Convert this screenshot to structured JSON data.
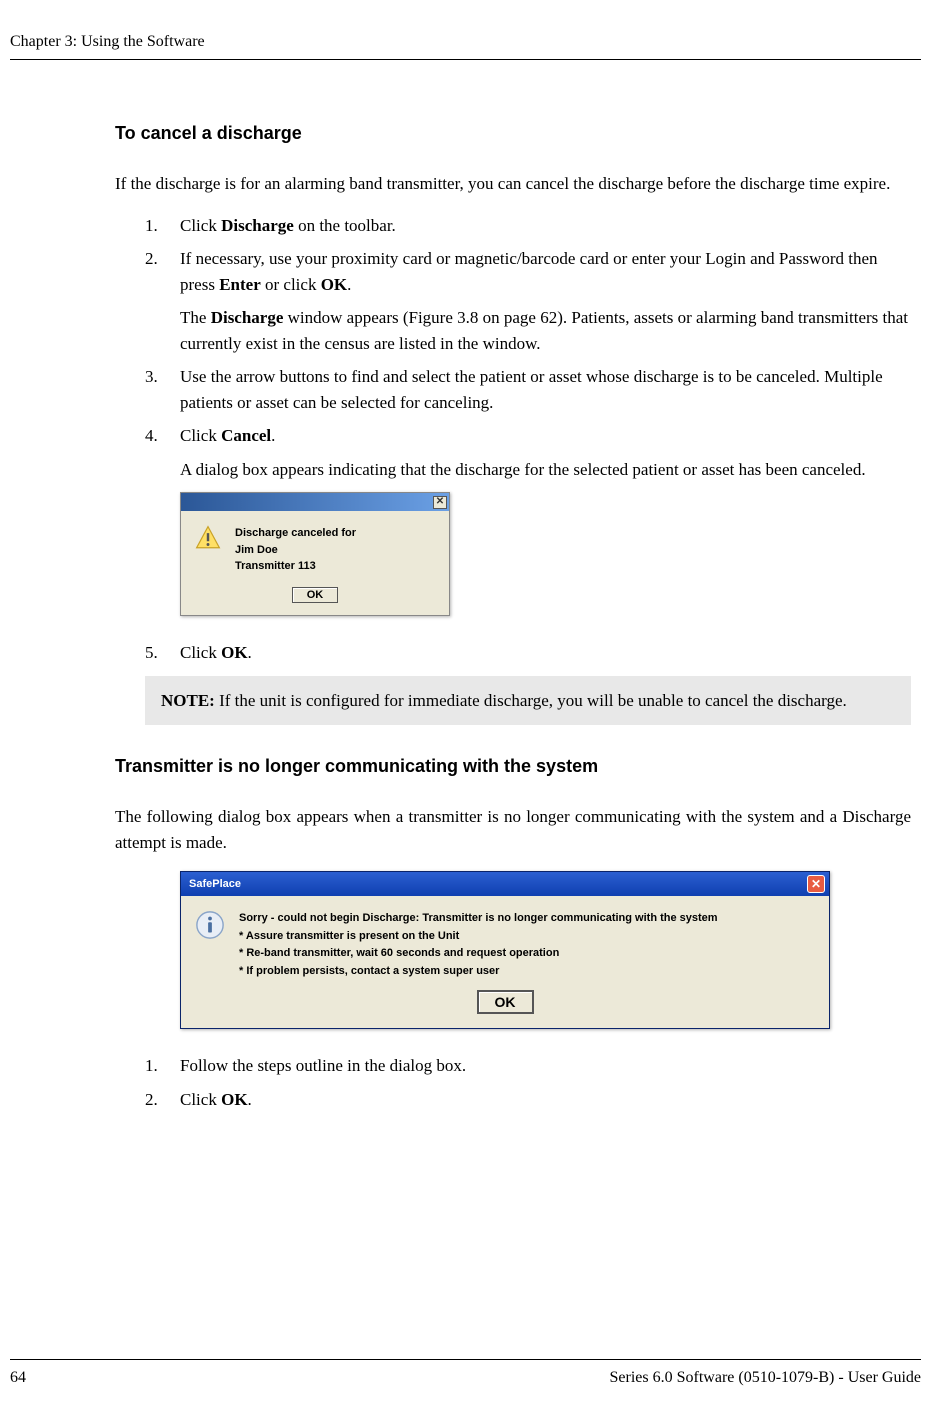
{
  "header": {
    "chapter": "Chapter 3: Using the Software"
  },
  "section1": {
    "title": "To cancel a discharge",
    "intro": "If the discharge is for an alarming band transmitter, you can cancel the discharge before the discharge time expire.",
    "steps": [
      {
        "num": "1.",
        "text_before": "Click ",
        "bold1": "Discharge",
        "text_after": " on the toolbar."
      },
      {
        "num": "2.",
        "text_before": "If necessary, use your proximity card or magnetic/barcode card or enter your Login and Password then press ",
        "bold1": "Enter",
        "text_mid": " or click ",
        "bold2": "OK",
        "text_after": ".",
        "sub_para": {
          "prefix": "The ",
          "bold": "Discharge",
          "suffix": " window appears (Figure 3.8 on page 62). Patients, assets or alarming band transmitters that currently exist in the census are listed in the window."
        }
      },
      {
        "num": "3.",
        "text": "Use the arrow buttons to find and select the patient or asset whose discharge is to be canceled. Multiple patients or asset can be selected for canceling."
      },
      {
        "num": "4.",
        "text_before": "Click ",
        "bold1": "Cancel",
        "text_after": ".",
        "sub_text": "A dialog box appears indicating that the discharge for the selected patient or asset has been canceled."
      },
      {
        "num": "5.",
        "text_before": "Click ",
        "bold1": "OK",
        "text_after": "."
      }
    ]
  },
  "dialog1": {
    "line1": "Discharge canceled for",
    "line2": "Jim Doe",
    "line3": "Transmitter 113",
    "ok": "OK"
  },
  "note": {
    "label": "NOTE:",
    "text": " If the unit is configured for immediate discharge, you will be unable to cancel the discharge."
  },
  "section2": {
    "title": "Transmitter is no longer communicating with the system",
    "intro": "The following dialog box appears when a transmitter is no longer communicating with the system and a Discharge attempt is made.",
    "steps": [
      {
        "num": "1.",
        "text": "Follow the steps outline in the dialog box."
      },
      {
        "num": "2.",
        "text_before": "Click ",
        "bold1": "OK",
        "text_after": "."
      }
    ]
  },
  "dialog2": {
    "title": "SafePlace",
    "line1": "Sorry - could not begin Discharge: Transmitter is no longer communicating with the system",
    "line2": "* Assure transmitter is present on the Unit",
    "line3": "* Re-band transmitter, wait 60 seconds and request operation",
    "line4": "* If problem persists, contact a system super user",
    "ok": "OK"
  },
  "footer": {
    "page": "64",
    "manual": "Series 6.0 Software (0510-1079-B) - User Guide"
  }
}
